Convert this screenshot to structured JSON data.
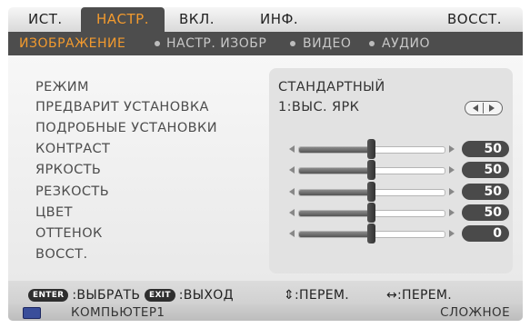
{
  "tabs": [
    {
      "label": "ИСТ."
    },
    {
      "label": "НАСТР."
    },
    {
      "label": "ВКЛ."
    },
    {
      "label": "ИНФ."
    },
    {
      "label": "ВОССТ."
    }
  ],
  "subtabs": [
    {
      "label": "ИЗОБРАЖЕНИЕ"
    },
    {
      "label": "НАСТР. ИЗОБР"
    },
    {
      "label": "ВИДЕО"
    },
    {
      "label": "АУДИО"
    }
  ],
  "items": {
    "mode_label": "РЕЖИМ",
    "mode_value": "СТАНДАРТНЫЙ",
    "preset_label": "ПРЕДВАРИТ УСТАНОВКА",
    "preset_value": "1:ВЫС. ЯРК",
    "detail_label": "ПОДРОБНЫЕ УСТАНОВКИ",
    "contrast_label": "КОНТРАСТ",
    "brightness_label": "ЯРКОСТЬ",
    "sharpness_label": "РЕЗКОСТЬ",
    "color_label": "ЦВЕТ",
    "hue_label": "ОТТЕНОК",
    "reset_label": "ВОССТ."
  },
  "sliders": {
    "contrast": {
      "value": "50",
      "level": 0.5
    },
    "brightness": {
      "value": "50",
      "level": 0.5
    },
    "sharpness": {
      "value": "50",
      "level": 0.5
    },
    "color": {
      "value": "50",
      "level": 0.5
    },
    "hue": {
      "value": "0",
      "level": 0.5
    }
  },
  "hints": {
    "enter_key": "ENTER",
    "enter_text": ":ВЫБРАТЬ",
    "exit_key": "EXIT",
    "exit_text": ":ВЫХОД",
    "updown_symbol": "⇕",
    "updown_text": ":ПЕРЕМ.",
    "leftright_symbol": "↔",
    "leftright_text": ":ПЕРЕМ."
  },
  "status": {
    "source": "КОМПЬЮТЕР1",
    "menu_mode": "СЛОЖНОЕ"
  },
  "colors": {
    "accent": "#f29a2e",
    "dark_bar": "#4d4d4d",
    "source_icon": "#3a4e9a"
  }
}
